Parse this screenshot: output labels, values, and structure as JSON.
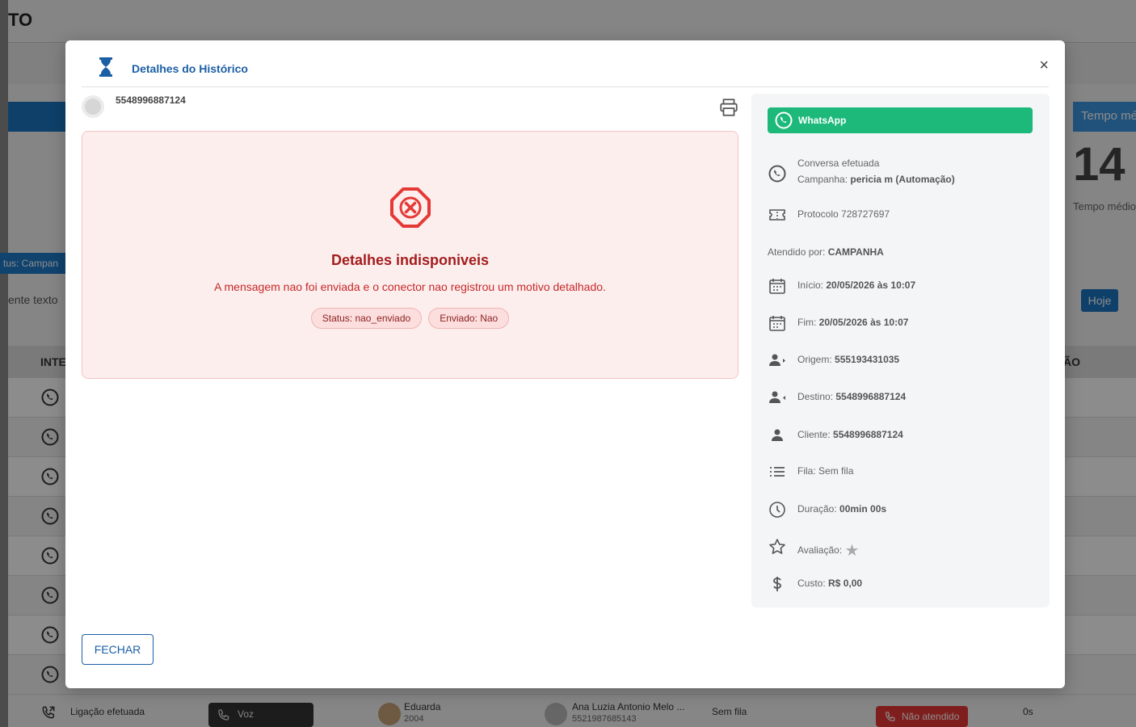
{
  "background": {
    "page_title": "TO",
    "tempo_button": "Tempo mé",
    "big_number": "14",
    "tempo_sub": "Tempo médio",
    "status_filter": "tus: Campan",
    "search_hint": "ente texto",
    "hoje_button": "Hoje",
    "table_header_left": "INTE",
    "table_header_right": "ÃO",
    "last_row": {
      "type": "Ligação efetuada",
      "channel": "Voz",
      "agent_name": "Eduarda",
      "agent_ext": "2004",
      "client_name": "Ana Luzia Antonio Melo ...",
      "client_number": "5521987685143",
      "queue": "Sem fila",
      "status": "Não atendido",
      "duration": "0s"
    }
  },
  "modal": {
    "title": "Detalhes do Histórico",
    "close": "×",
    "contact_number": "5548996887124",
    "error": {
      "title": "Detalhes indisponiveis",
      "message": "A mensagem nao foi enviada e o conector nao registrou um motivo detalhado.",
      "chip_status": "Status: nao_enviado",
      "chip_sent": "Enviado: Nao"
    },
    "close_button": "FECHAR"
  },
  "side": {
    "channel": "WhatsApp",
    "conversation_type": "Conversa efetuada",
    "campaign_label": "Campanha: ",
    "campaign_value": "pericia m (Automação)",
    "protocol": "Protocolo 728727697",
    "attended_label": "Atendido por: ",
    "attended_value": "CAMPANHA",
    "start_label": "Início: ",
    "start_value": "20/05/2026 às 10:07",
    "end_label": "Fim: ",
    "end_value": "20/05/2026 às 10:07",
    "origin_label": "Origem: ",
    "origin_value": "555193431035",
    "dest_label": "Destino: ",
    "dest_value": "5548996887124",
    "client_label": "Cliente: ",
    "client_value": "5548996887124",
    "queue_label": "Fila: ",
    "queue_value": "Sem fila",
    "duration_label": "Duração: ",
    "duration_value": "00min 00s",
    "rating_label": "Avaliação: ",
    "cost_label": "Custo: ",
    "cost_value": "R$ 0,00"
  },
  "colors": {
    "primary": "#1b5fa5",
    "whatsapp": "#1db97a",
    "error_text": "#c62828",
    "error_bg": "#fdeeee"
  }
}
